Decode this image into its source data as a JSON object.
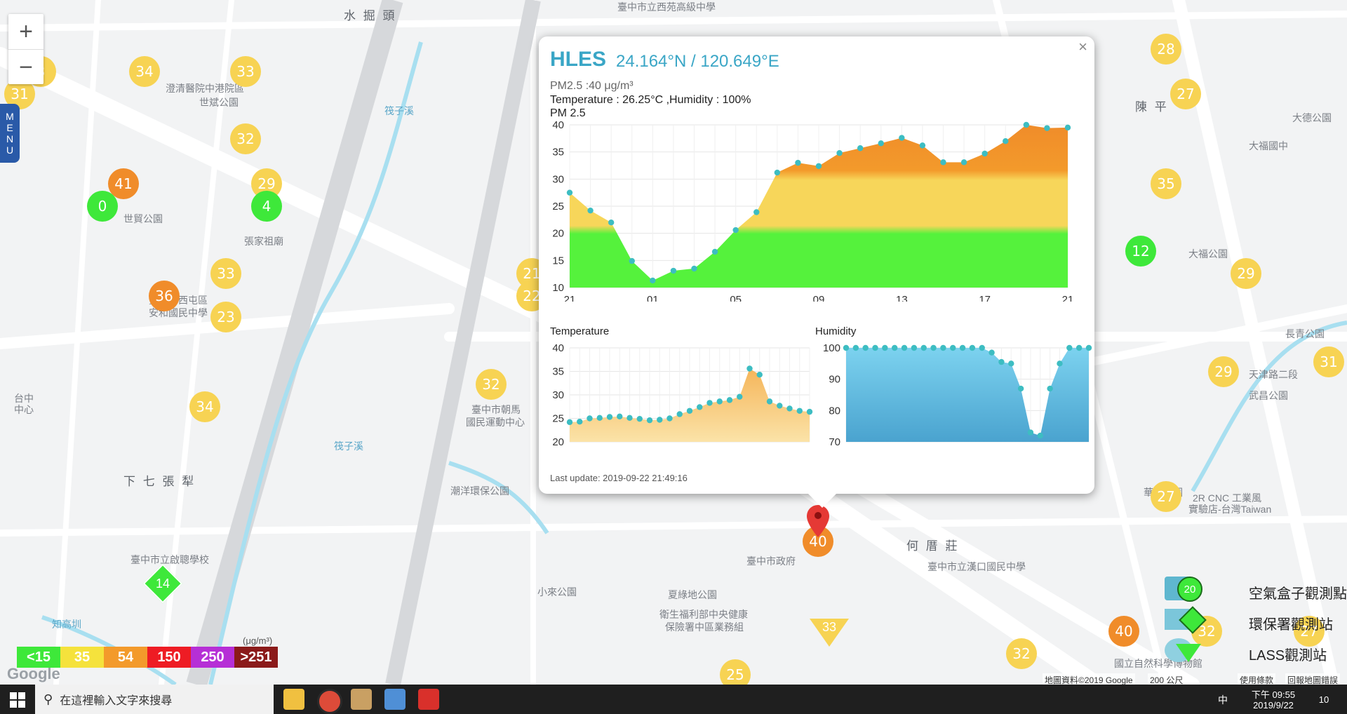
{
  "map": {
    "labels": [
      {
        "text": "水 掘 頭",
        "x": 490,
        "y": 8,
        "cls": "big"
      },
      {
        "text": "臺中市立西苑高級中學",
        "x": 880,
        "y": 0,
        "cls": ""
      },
      {
        "text": "澄清醫院中港院區",
        "x": 236,
        "y": 116,
        "cls": ""
      },
      {
        "text": "世斌公園",
        "x": 284,
        "y": 136,
        "cls": ""
      },
      {
        "text": "世貿公園",
        "x": 176,
        "y": 302,
        "cls": ""
      },
      {
        "text": "張家祖廟",
        "x": 348,
        "y": 334,
        "cls": ""
      },
      {
        "text": "臺中市西屯區",
        "x": 212,
        "y": 418,
        "cls": ""
      },
      {
        "text": "安和國民中學",
        "x": 212,
        "y": 436,
        "cls": ""
      },
      {
        "text": "下 七 張 犁",
        "x": 176,
        "y": 672,
        "cls": "big"
      },
      {
        "text": "臺中市立啟聰學校",
        "x": 186,
        "y": 788,
        "cls": ""
      },
      {
        "text": "潮洋環保公園",
        "x": 642,
        "y": 690,
        "cls": ""
      },
      {
        "text": "臺中市朝馬",
        "x": 672,
        "y": 574,
        "cls": ""
      },
      {
        "text": "國民運動中心",
        "x": 664,
        "y": 592,
        "cls": ""
      },
      {
        "text": "何 厝 莊",
        "x": 1292,
        "y": 764,
        "cls": "big"
      },
      {
        "text": "臺中市政府",
        "x": 1064,
        "y": 790,
        "cls": ""
      },
      {
        "text": "夏綠地公園",
        "x": 952,
        "y": 838,
        "cls": ""
      },
      {
        "text": "衛生福利部中央健康",
        "x": 940,
        "y": 866,
        "cls": ""
      },
      {
        "text": "保險署中區業務組",
        "x": 948,
        "y": 884,
        "cls": ""
      },
      {
        "text": "小來公園",
        "x": 766,
        "y": 834,
        "cls": ""
      },
      {
        "text": "臺中市立漢口國民中學",
        "x": 1322,
        "y": 798,
        "cls": ""
      },
      {
        "text": "陳 平",
        "x": 1618,
        "y": 138,
        "cls": "big"
      },
      {
        "text": "大德公園",
        "x": 1842,
        "y": 158,
        "cls": ""
      },
      {
        "text": "大福國中",
        "x": 1780,
        "y": 198,
        "cls": ""
      },
      {
        "text": "大福公園",
        "x": 1694,
        "y": 352,
        "cls": ""
      },
      {
        "text": "長青公園",
        "x": 1832,
        "y": 466,
        "cls": ""
      },
      {
        "text": "武昌公園",
        "x": 1780,
        "y": 554,
        "cls": ""
      },
      {
        "text": "天津路二段",
        "x": 1780,
        "y": 524,
        "cls": ""
      },
      {
        "text": "華美公園",
        "x": 1630,
        "y": 692,
        "cls": ""
      },
      {
        "text": "2R CNC 工業風",
        "x": 1700,
        "y": 700,
        "cls": ""
      },
      {
        "text": "實驗店-台灣Taiwan",
        "x": 1694,
        "y": 716,
        "cls": ""
      },
      {
        "text": "國立自然科學博物館",
        "x": 1588,
        "y": 936,
        "cls": ""
      },
      {
        "text": "台中",
        "x": 20,
        "y": 558,
        "cls": ""
      },
      {
        "text": "中心",
        "x": 20,
        "y": 574,
        "cls": ""
      },
      {
        "text": "知高圳",
        "x": 74,
        "y": 880,
        "cls": "blue"
      },
      {
        "text": "筏子溪",
        "x": 476,
        "y": 626,
        "cls": "blue"
      },
      {
        "text": "筏子溪",
        "x": 548,
        "y": 148,
        "cls": "blue"
      }
    ],
    "markers": [
      {
        "v": "34",
        "x": 206,
        "y": 102,
        "r": 22,
        "c": "y"
      },
      {
        "v": "33",
        "x": 350,
        "y": 102,
        "r": 22,
        "c": "y"
      },
      {
        "v": "3",
        "x": 58,
        "y": 102,
        "r": 22,
        "c": "y"
      },
      {
        "v": "31",
        "x": 28,
        "y": 134,
        "r": 22,
        "c": "y"
      },
      {
        "v": "32",
        "x": 350,
        "y": 198,
        "r": 22,
        "c": "y"
      },
      {
        "v": "29",
        "x": 380,
        "y": 262,
        "r": 22,
        "c": "y"
      },
      {
        "v": "41",
        "x": 176,
        "y": 262,
        "r": 22,
        "c": "o"
      },
      {
        "v": "0",
        "x": 146,
        "y": 294,
        "r": 22,
        "c": "g"
      },
      {
        "v": "4",
        "x": 380,
        "y": 294,
        "r": 22,
        "c": "g"
      },
      {
        "v": "33",
        "x": 322,
        "y": 390,
        "r": 22,
        "c": "y"
      },
      {
        "v": "36",
        "x": 234,
        "y": 422,
        "r": 22,
        "c": "o"
      },
      {
        "v": "23",
        "x": 322,
        "y": 452,
        "r": 22,
        "c": "y"
      },
      {
        "v": "34",
        "x": 292,
        "y": 580,
        "r": 22,
        "c": "y"
      },
      {
        "v": "32",
        "x": 700,
        "y": 548,
        "r": 22,
        "c": "y"
      },
      {
        "v": "21",
        "x": 758,
        "y": 390,
        "r": 22,
        "c": "y"
      },
      {
        "v": "22",
        "x": 758,
        "y": 422,
        "r": 22,
        "c": "y"
      },
      {
        "v": "40",
        "x": 1166,
        "y": 772,
        "r": 22,
        "c": "o"
      },
      {
        "v": "28",
        "x": 1662,
        "y": 70,
        "r": 22,
        "c": "y"
      },
      {
        "v": "27",
        "x": 1690,
        "y": 134,
        "r": 22,
        "c": "y"
      },
      {
        "v": "35",
        "x": 1662,
        "y": 262,
        "r": 22,
        "c": "y"
      },
      {
        "v": "12",
        "x": 1626,
        "y": 358,
        "r": 22,
        "c": "g"
      },
      {
        "v": "29",
        "x": 1776,
        "y": 390,
        "r": 22,
        "c": "y"
      },
      {
        "v": "31",
        "x": 1894,
        "y": 516,
        "r": 22,
        "c": "y"
      },
      {
        "v": "29",
        "x": 1744,
        "y": 530,
        "r": 22,
        "c": "y"
      },
      {
        "v": "27",
        "x": 1662,
        "y": 708,
        "r": 22,
        "c": "y"
      },
      {
        "v": "40",
        "x": 1602,
        "y": 900,
        "r": 22,
        "c": "o"
      },
      {
        "v": "32",
        "x": 1720,
        "y": 900,
        "r": 22,
        "c": "y"
      },
      {
        "v": "32",
        "x": 1456,
        "y": 932,
        "r": 22,
        "c": "y"
      },
      {
        "v": "25",
        "x": 1048,
        "y": 962,
        "r": 22,
        "c": "y"
      },
      {
        "v": "27",
        "x": 1866,
        "y": 900,
        "r": 22,
        "c": "y"
      }
    ],
    "diamond": {
      "v": "14",
      "x": 230,
      "y": 830
    },
    "triangle": {
      "v": "33",
      "x": 1182,
      "y": 902
    }
  },
  "zoom": {
    "in": "+",
    "out": "−"
  },
  "menu": {
    "label": "MENU"
  },
  "legend": {
    "unit": "(μg/m³)",
    "items": [
      {
        "label": "<15",
        "color": "#3ee83a"
      },
      {
        "label": "35",
        "color": "#f5e23c"
      },
      {
        "label": "54",
        "color": "#f39a2b"
      },
      {
        "label": "150",
        "color": "#ee1c24"
      },
      {
        "label": "250",
        "color": "#b62fd6"
      },
      {
        "label": ">251",
        "color": "#8b1a1a"
      }
    ]
  },
  "station_legend": {
    "airbox": "空氣盒子觀測點",
    "epa": "環保署觀測站",
    "lass": "LASS觀測站",
    "sample": "20"
  },
  "google": {
    "logo": "Google",
    "mapdata": "地圖資料©2019 Google",
    "scale": "200 公尺",
    "terms": "使用條款",
    "report": "回報地圖錯誤"
  },
  "popup": {
    "site": "HLES",
    "coords": "24.164°N / 120.649°E",
    "pm_line": "PM2.5 :40 μg/m³",
    "env_line": "Temperature : 26.25°C ,Humidity : 100%",
    "chart_title": "PM 2.5",
    "temp_title": "Temperature",
    "hum_title": "Humidity",
    "last_update": "Last update: 2019-09-22 21:49:16",
    "close": "×"
  },
  "chart_data": [
    {
      "type": "area",
      "title": "PM 2.5",
      "x_ticks": [
        "21",
        "01",
        "05",
        "09",
        "13",
        "17",
        "21"
      ],
      "ylim": [
        10,
        40
      ],
      "y_ticks": [
        10,
        15,
        20,
        25,
        30,
        35,
        40
      ],
      "values": [
        27.5,
        24.2,
        22,
        14.9,
        11.3,
        13.1,
        13.5,
        16.6,
        20.6,
        23.9,
        31.2,
        33,
        32.4,
        34.8,
        35.7,
        36.6,
        37.6,
        36.2,
        33.1,
        33.1,
        34.7,
        37,
        40,
        39.4,
        39.5
      ]
    },
    {
      "type": "area",
      "title": "Temperature",
      "ylim": [
        20,
        40
      ],
      "y_ticks": [
        20,
        25,
        30,
        35,
        40
      ],
      "values": [
        24.2,
        24.3,
        25,
        25.1,
        25.3,
        25.4,
        25.1,
        24.9,
        24.6,
        24.7,
        25,
        25.9,
        26.6,
        27.4,
        28.3,
        28.6,
        28.9,
        29.6,
        35.6,
        34.3,
        28.6,
        27.7,
        27.1,
        26.6,
        26.4
      ]
    },
    {
      "type": "area",
      "title": "Humidity",
      "ylim": [
        70,
        100
      ],
      "y_ticks": [
        70,
        80,
        90,
        100
      ],
      "values": [
        100,
        100,
        100,
        100,
        100,
        100,
        100,
        100,
        100,
        100,
        100,
        100,
        100,
        100,
        100,
        98.5,
        95.5,
        95,
        87,
        73,
        72,
        87,
        95,
        100,
        100,
        100
      ]
    }
  ],
  "taskbar": {
    "search_placeholder": "在這裡輸入文字來搜尋",
    "time": "下午 09:55",
    "date": "2019/9/22",
    "ime": "中",
    "notif": "10"
  }
}
